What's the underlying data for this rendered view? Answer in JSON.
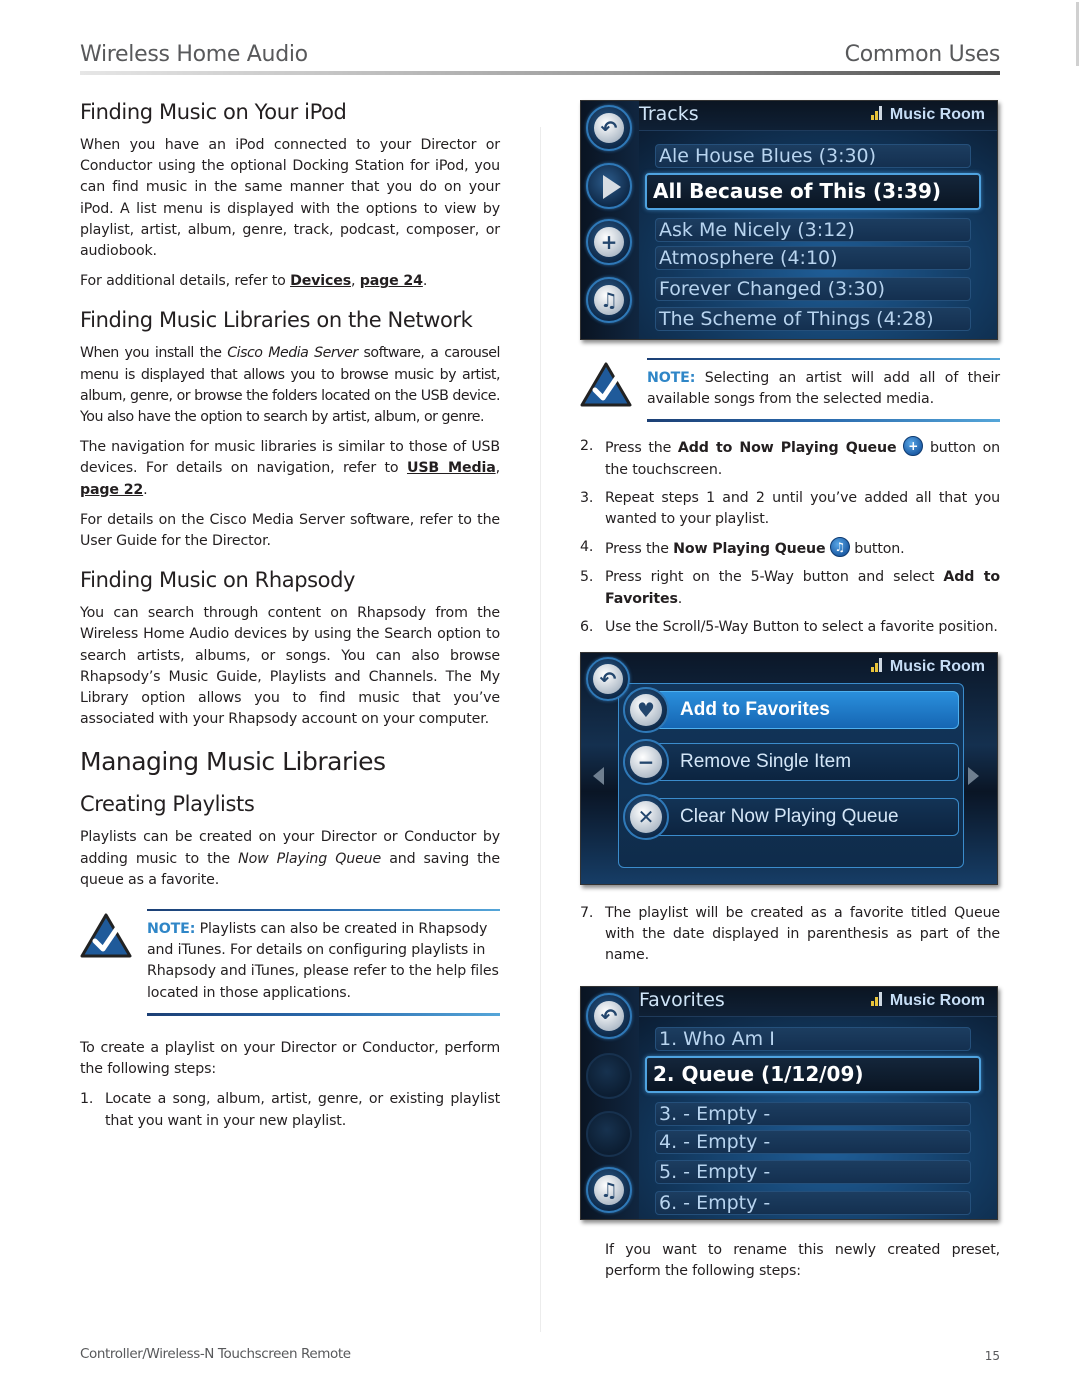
{
  "header": {
    "left": "Wireless Home Audio",
    "right": "Common Uses"
  },
  "left": {
    "ipod": {
      "title": "Finding Music on Your iPod",
      "body": "When you have an iPod connected to your Director or Conductor using the optional Docking Station for iPod, you can find music in the same manner that you do on your iPod. A list menu is displayed with the options to view by playlist, artist, album, genre, track, podcast, composer, or audiobook.",
      "ref_prefix": "For additional details, refer to ",
      "ref_link1": "Devices",
      "ref_sep": ", ",
      "ref_link2": "page 24",
      "ref_suffix": "."
    },
    "network": {
      "title": "Finding Music Libraries on the Network",
      "p1_a": "When you install the ",
      "p1_em": "Cisco Media Server",
      "p1_b": " software, a carousel menu is displayed that allows you to browse music by artist, album, genre, or browse the folders located on the USB device. You also have the option to search by artist, album, or genre.",
      "p2_a": "The navigation for music libraries is similar to those of USB devices. For details on navigation, refer to ",
      "p2_link1": "USB Media",
      "p2_sep": ", ",
      "p2_link2": "page 22",
      "p2_suffix": ".",
      "p3": "For details on the Cisco Media Server software, refer to the User Guide for the Director."
    },
    "rhapsody": {
      "title": "Finding Music on Rhapsody",
      "body": "You can search through content on Rhapsody from the Wireless Home Audio devices by using the Search option to search artists, albums, or songs. You can also browse Rhapsody’s Music Guide, Playlists and Channels. The My Library option allows you to find music that you’ve associated with your Rhapsody account on your computer."
    },
    "managing": {
      "title": "Managing Music Libraries"
    },
    "playlists": {
      "title": "Creating Playlists",
      "p1_a": "Playlists can be created on your Director or Conductor by adding music to the ",
      "p1_em": "Now Playing Queue",
      "p1_b": " and saving the queue as a favorite.",
      "note_label": "NOTE:",
      "note_text": " Playlists can also be created in Rhapsody and iTunes. For details on configuring playlists in Rhapsody and iTunes, please refer to the help files located in those applications.",
      "p2": "To create a playlist on your Director or Conductor, perform the following steps:",
      "step1_num": "1.",
      "step1": "Locate a song, album, artist, genre, or existing playlist that you want in your new playlist."
    }
  },
  "right": {
    "screen1": {
      "title": "Tracks",
      "room": "Music Room",
      "sidebar_icons": [
        "back-icon",
        "play-icon",
        "add-to-queue-icon",
        "now-playing-queue-icon"
      ],
      "tracks": [
        {
          "label": "Ale House Blues (3:30)",
          "selected": false
        },
        {
          "label": "All Because of This (3:39)",
          "selected": true
        },
        {
          "label": "Ask Me Nicely (3:12)",
          "selected": false
        },
        {
          "label": "Atmosphere (4:10)",
          "selected": false
        },
        {
          "label": "Forever Changed (3:30)",
          "selected": false
        },
        {
          "label": "The Scheme of Things (4:28)",
          "selected": false
        }
      ]
    },
    "note": {
      "label": "NOTE:",
      "text": " Selecting an artist will add all of their available songs from the selected media."
    },
    "steps": {
      "s2_num": "2.",
      "s2_a": "Press the ",
      "s2_b": "Add to Now Playing Queue",
      "s2_icon": "add-to-queue-icon",
      "s2_c": " button on the touchscreen.",
      "s3_num": "3.",
      "s3": "Repeat steps 1 and 2 until you’ve added all that you wanted to your playlist.",
      "s4_num": "4.",
      "s4_a": "Press the ",
      "s4_b": "Now Playing Queue",
      "s4_icon": "now-playing-queue-icon",
      "s4_c": " button.",
      "s5_num": "5.",
      "s5_a": "Press right on the 5-Way button and select ",
      "s5_b": "Add to Favorites",
      "s5_c": ".",
      "s6_num": "6.",
      "s6": "Use the Scroll/5-Way Button to select a favorite position.",
      "s7_num": "7.",
      "s7": "The playlist will be created as a favorite titled Queue with the date displayed in parenthesis as part of the name."
    },
    "screen2": {
      "room": "Music Room",
      "menu": [
        {
          "label": "Add to Favorites",
          "icon": "heart-icon",
          "selected": true
        },
        {
          "label": "Remove Single Item",
          "icon": "remove-icon",
          "selected": false
        },
        {
          "label": "Clear Now Playing Queue",
          "icon": "clear-icon",
          "selected": false
        }
      ]
    },
    "screen3": {
      "title": "Favorites",
      "room": "Music Room",
      "items": [
        {
          "label": "1. Who Am I",
          "selected": false
        },
        {
          "label": "2. Queue (1/12/09)",
          "selected": true
        },
        {
          "label": "3. - Empty -",
          "selected": false
        },
        {
          "label": "4. - Empty -",
          "selected": false
        },
        {
          "label": "5. - Empty -",
          "selected": false
        },
        {
          "label": "6. - Empty -",
          "selected": false
        }
      ]
    },
    "closing": "If you want to rename this newly created preset, perform the following steps:"
  },
  "footer": {
    "left": "Controller/Wireless-N Touchscreen Remote",
    "page": "15"
  },
  "colors": {
    "note_blue": "#2f86c7",
    "screen_accent": "#4fa3e0",
    "signal_yellow": "#e9c43a"
  }
}
